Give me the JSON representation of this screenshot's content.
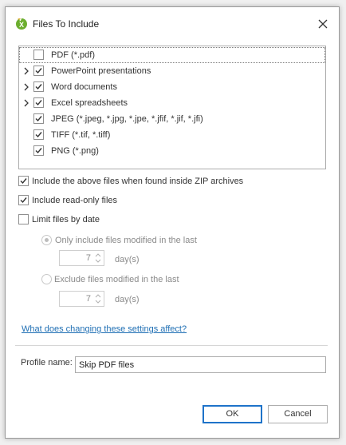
{
  "window": {
    "title": "Files To Include"
  },
  "file_types": [
    {
      "label": "PDF (*.pdf)",
      "checked": false,
      "expandable": false,
      "selected": true
    },
    {
      "label": "PowerPoint presentations",
      "checked": true,
      "expandable": true,
      "selected": false
    },
    {
      "label": "Word documents",
      "checked": true,
      "expandable": true,
      "selected": false
    },
    {
      "label": "Excel spreadsheets",
      "checked": true,
      "expandable": true,
      "selected": false
    },
    {
      "label": "JPEG (*.jpeg, *.jpg, *.jpe, *.jfif, *.jif, *.jfi)",
      "checked": true,
      "expandable": false,
      "selected": false
    },
    {
      "label": "TIFF (*.tif, *.tiff)",
      "checked": true,
      "expandable": false,
      "selected": false
    },
    {
      "label": "PNG (*.png)",
      "checked": true,
      "expandable": false,
      "selected": false
    }
  ],
  "options": {
    "zip": {
      "label": "Include the above files when found inside ZIP archives",
      "checked": true
    },
    "readonly": {
      "label": "Include read-only files",
      "checked": true
    },
    "limit_date": {
      "label": "Limit files by date",
      "checked": false
    }
  },
  "date_filter": {
    "only_label": "Only include files modified in the last",
    "only_value": "7",
    "only_unit": "day(s)",
    "exclude_label": "Exclude files modified in the last",
    "exclude_value": "7",
    "exclude_unit": "day(s)"
  },
  "help_link": "What does changing these settings affect?",
  "profile": {
    "label": "Profile name:",
    "value": "Skip PDF files"
  },
  "buttons": {
    "ok": "OK",
    "cancel": "Cancel"
  },
  "colors": {
    "accent": "#1e73c9",
    "link": "#1f6fb4",
    "check": "#333333"
  }
}
